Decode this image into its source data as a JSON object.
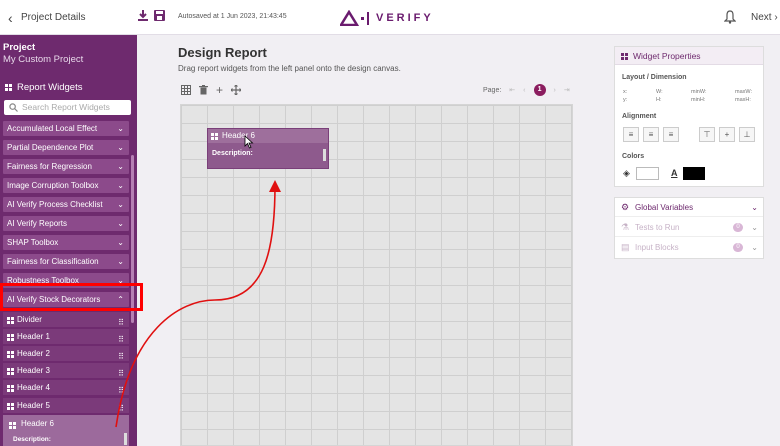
{
  "topbar": {
    "back_label": "Project Details",
    "autosave": "Autosaved at 1 Jun 2023, 21:43:45",
    "logo_text": "VERIFY",
    "next_label": "Next"
  },
  "sidebar": {
    "project_label": "Project",
    "project_name": "My Custom Project",
    "section_title": "Report Widgets",
    "search_placeholder": "Search Report Widgets",
    "groups": [
      "Accumulated Local Effect",
      "Partial Dependence Plot",
      "Fairness for Regression",
      "Image Corruption Toolbox",
      "AI Verify Process Checklist",
      "AI Verify Reports",
      "SHAP Toolbox",
      "Fairness for Classification",
      "Robustness Toolbox",
      "AI Verify Stock Decorators"
    ],
    "decorators": [
      "Divider",
      "Header 1",
      "Header 2",
      "Header 3",
      "Header 4",
      "Header 5"
    ],
    "dragging": {
      "title": "Header 6",
      "desc": "Description:"
    }
  },
  "main": {
    "title": "Design Report",
    "subtitle": "Drag report widgets from the left panel onto the design canvas.",
    "page_label": "Page:",
    "page_number": "1",
    "widget": {
      "title": "Header 6",
      "desc": "Description:"
    }
  },
  "properties": {
    "title": "Widget Properties",
    "layout_label": "Layout / Dimension",
    "x": "x:",
    "y": "y:",
    "w": "W:",
    "h": "H:",
    "minw": "minW:",
    "minh": "minH:",
    "maxw": "maxW:",
    "maxh": "maxH:",
    "alignment_label": "Alignment",
    "colors_label": "Colors",
    "text_color_letter": "A"
  },
  "globals": {
    "title": "Global Variables",
    "tests": "Tests to Run",
    "tests_count": "0",
    "inputs": "Input Blocks",
    "inputs_count": "0"
  },
  "colors": {
    "accent": "#6e2a6e",
    "brand": "#8b1d5f",
    "highlight": "#ff0000",
    "arrow": "#e01010"
  }
}
